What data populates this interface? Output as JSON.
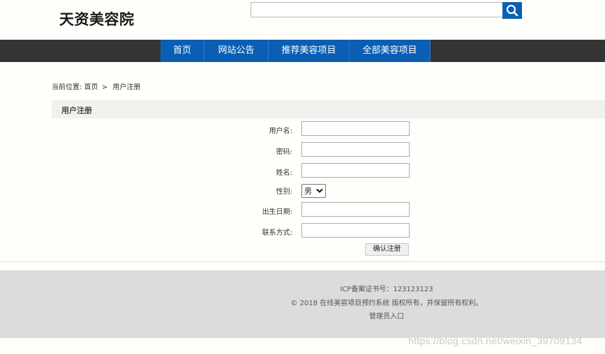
{
  "header": {
    "logo_text": "天资美容院",
    "search": {
      "value": "",
      "placeholder": ""
    },
    "search_button_icon": "search-icon"
  },
  "nav": {
    "items": [
      {
        "label": "首页"
      },
      {
        "label": "网站公告"
      },
      {
        "label": "推荐美容项目"
      },
      {
        "label": "全部美容项目"
      }
    ]
  },
  "breadcrumb": {
    "prefix": "当前位置:",
    "home": "首页",
    "separator": ">",
    "current": "用户注册"
  },
  "section": {
    "title": "用户注册"
  },
  "form": {
    "username_label": "用户名:",
    "password_label": "密码:",
    "name_label": "姓名:",
    "gender_label": "性别:",
    "gender_value": "男",
    "birthdate_label": "出生日期:",
    "contact_label": "联系方式:",
    "submit_label": "确认注册"
  },
  "footer": {
    "icp": "ICP备案证书号：123123123",
    "copyright": "© 2018 在线美容项目预约系统 版权所有，并保留所有权利。",
    "admin_link": "管理员入口"
  },
  "watermark": "https://blog.csdn.net/weixin_39709134",
  "colors": {
    "nav_active": "#0a5fb4",
    "navbar_bg": "#343434",
    "footer_bg": "#dcdcdc"
  }
}
